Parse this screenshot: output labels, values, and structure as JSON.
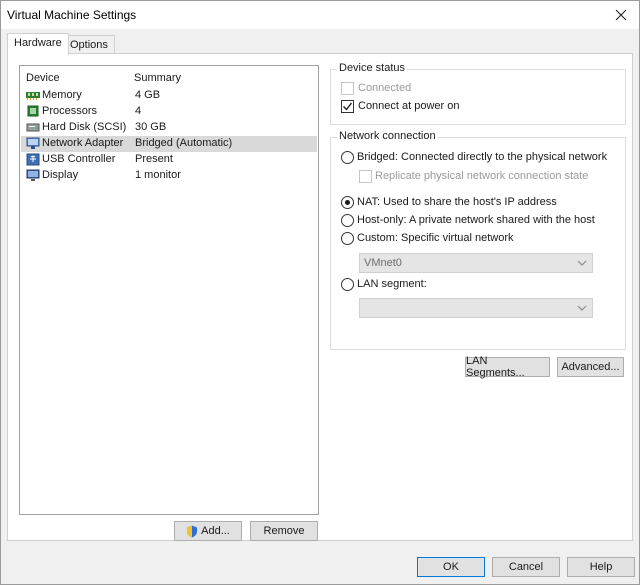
{
  "window": {
    "title": "Virtual Machine Settings"
  },
  "tabs": [
    {
      "label": "Hardware",
      "active": true
    },
    {
      "label": "Options",
      "active": false
    }
  ],
  "device_list": {
    "columns": [
      "Device",
      "Summary"
    ],
    "rows": [
      {
        "device": "Memory",
        "summary": "4 GB",
        "icon": "memory-icon"
      },
      {
        "device": "Processors",
        "summary": "4",
        "icon": "processor-icon"
      },
      {
        "device": "Hard Disk (SCSI)",
        "summary": "30 GB",
        "icon": "hard-disk-icon"
      },
      {
        "device": "Network Adapter",
        "summary": "Bridged (Automatic)",
        "icon": "network-adapter-icon",
        "selected": true
      },
      {
        "device": "USB Controller",
        "summary": "Present",
        "icon": "usb-icon"
      },
      {
        "device": "Display",
        "summary": "1 monitor",
        "icon": "display-icon"
      }
    ],
    "add_label": "Add...",
    "remove_label": "Remove"
  },
  "device_status": {
    "label": "Device status",
    "connected_label": "Connected",
    "connected_checked": false,
    "connected_enabled": false,
    "power_on_label": "Connect at power on",
    "power_on_checked": true
  },
  "network_connection": {
    "label": "Network connection",
    "bridged_label": "Bridged: Connected directly to the physical network",
    "replicate_label": "Replicate physical network connection state",
    "nat_label": "NAT: Used to share the host's IP address",
    "host_only_label": "Host-only: A private network shared with the host",
    "custom_label": "Custom: Specific virtual network",
    "custom_value": "VMnet0",
    "lan_segment_label": "LAN segment:",
    "lan_segment_value": "",
    "selected": "NAT"
  },
  "buttons": {
    "lan_segments": "LAN Segments...",
    "advanced": "Advanced...",
    "ok": "OK",
    "cancel": "Cancel",
    "help": "Help"
  },
  "colors": {
    "selection": "#d9d9d9",
    "default_button_border": "#0078d7"
  }
}
